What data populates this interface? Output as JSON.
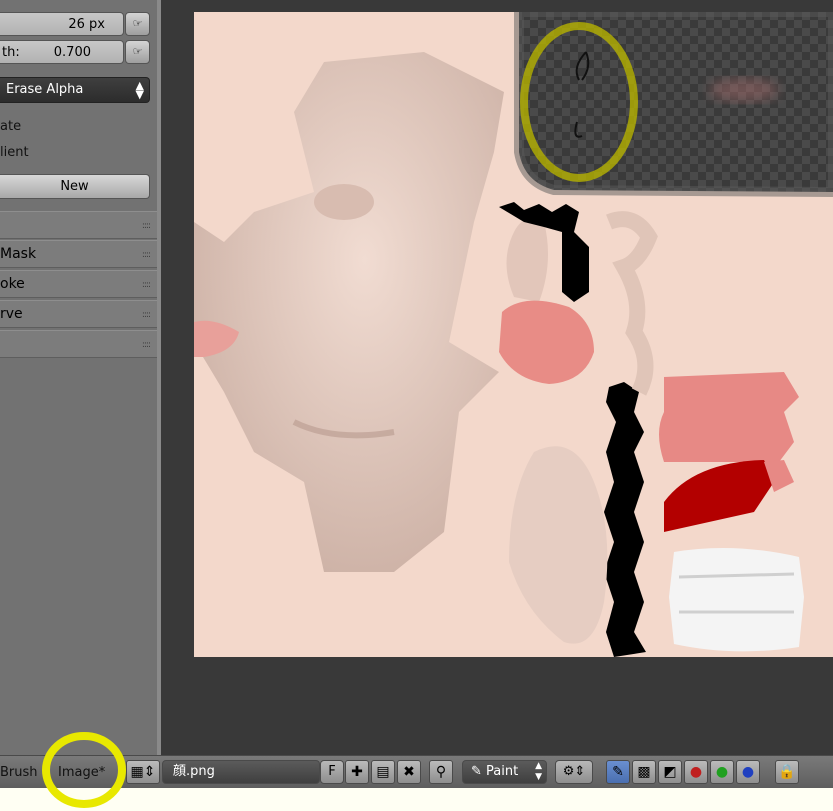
{
  "brush": {
    "radius_label": "",
    "radius_value": "26 px",
    "strength_label": "th:",
    "strength_value": "0.700",
    "blend_mode": "Erase Alpha",
    "option1": "ate",
    "option2": "lient",
    "new_label": "New"
  },
  "sections": [
    {
      "label": ""
    },
    {
      "label": "Mask"
    },
    {
      "label": "oke"
    },
    {
      "label": "rve"
    },
    {
      "label": ""
    }
  ],
  "header": {
    "brush_label": "Brush",
    "image_menu": "Image*",
    "image_name": "顔.png",
    "fake_user": "F",
    "mode": "Paint"
  },
  "colors": {
    "panel": "#727272",
    "canvas": "#f3d8cb",
    "viewport": "#393939",
    "highlight": "#e8e800"
  }
}
